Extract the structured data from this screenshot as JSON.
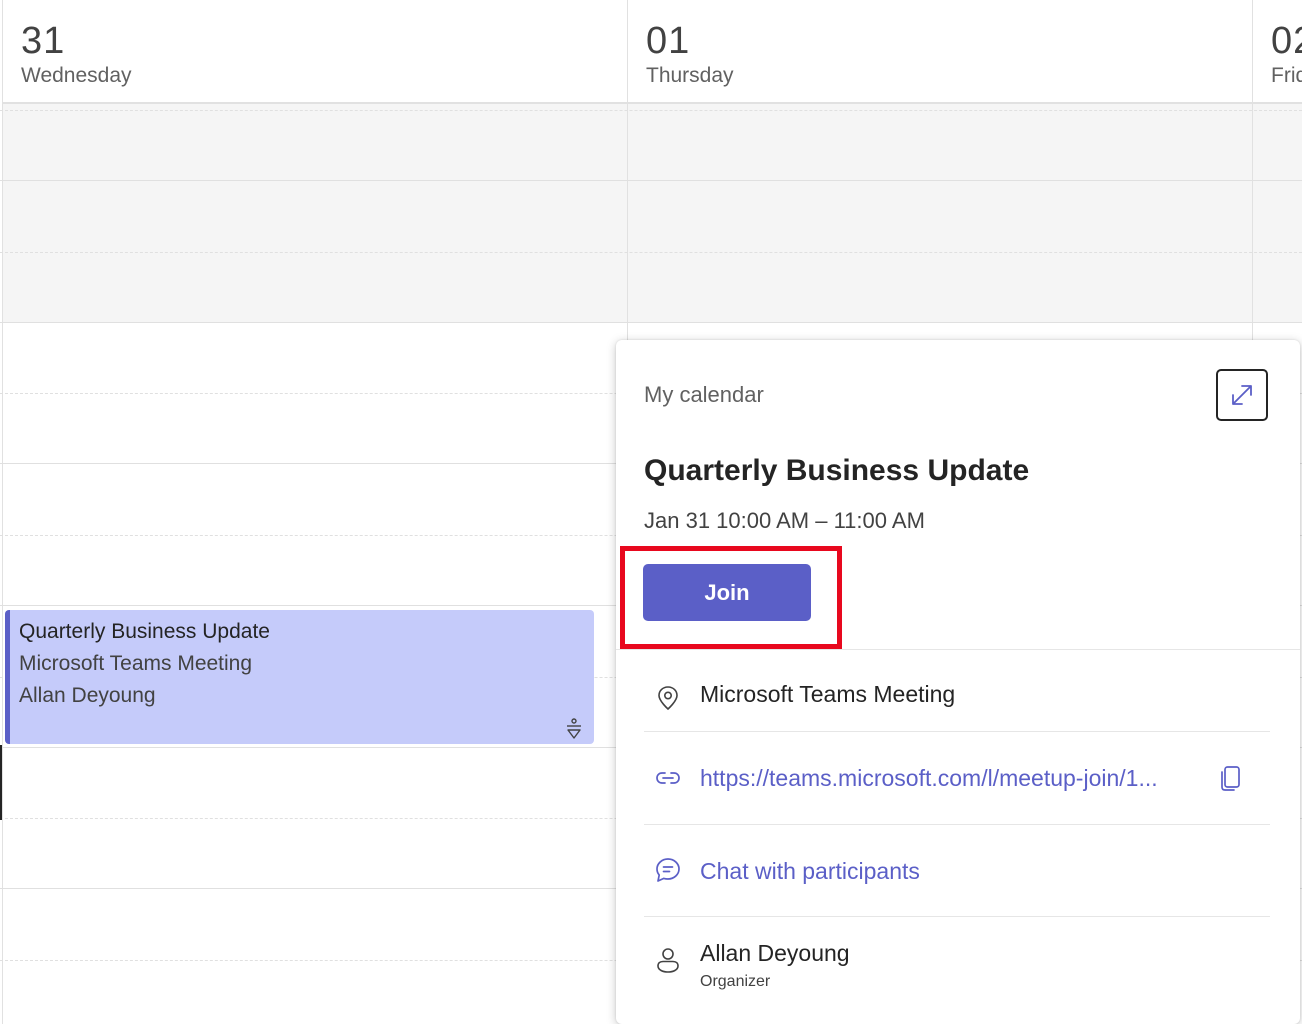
{
  "days": [
    {
      "num": "31",
      "name": "Wednesday"
    },
    {
      "num": "01",
      "name": "Thursday"
    },
    {
      "num": "02",
      "name": "Friday"
    }
  ],
  "event": {
    "title": "Quarterly Business Update",
    "location": "Microsoft Teams Meeting",
    "organizer": "Allan Deyoung",
    "color": "#c5cbfa",
    "accent": "#5b5fc7"
  },
  "popup": {
    "calendar_name": "My calendar",
    "title": "Quarterly Business Update",
    "time": "Jan 31 10:00 AM – 11:00 AM",
    "join_label": "Join",
    "location": "Microsoft Teams Meeting",
    "link": "https://teams.microsoft.com/l/meetup-join/1...",
    "chat_label": "Chat with participants",
    "organizer_name": "Allan Deyoung",
    "organizer_role": "Organizer",
    "icons": [
      "expand-icon",
      "location-icon",
      "link-icon",
      "copy-icon",
      "chat-icon",
      "person-icon"
    ],
    "highlight_color": "#e8081e"
  }
}
